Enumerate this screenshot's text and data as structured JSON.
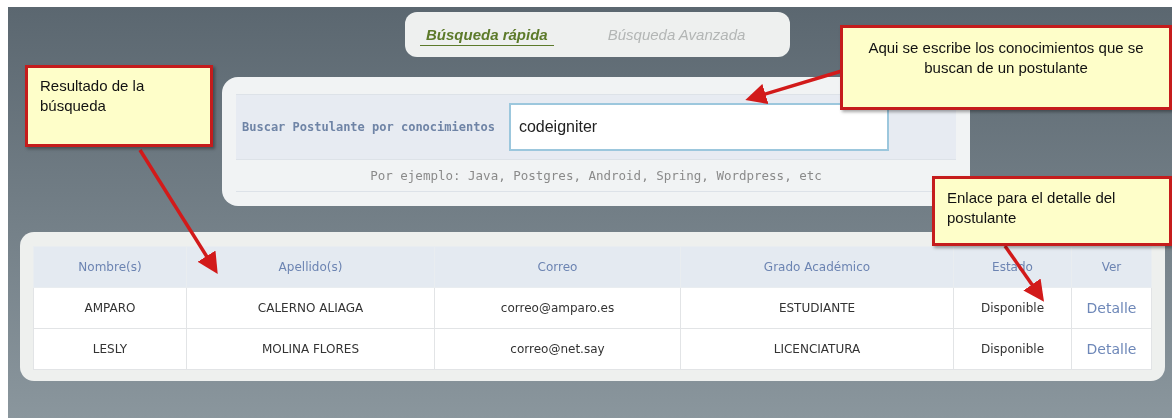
{
  "tabs": [
    {
      "label": "Búsqueda rápida",
      "selected": true
    },
    {
      "label": "Búsqueda Avanzada",
      "selected": false
    }
  ],
  "search": {
    "label": "Buscar Postulante por conocimientos",
    "value": "codeigniter",
    "hint": "Por ejemplo: Java, Postgres, Android, Spring, Wordpress, etc"
  },
  "table": {
    "columns": [
      "Nombre(s)",
      "Apellido(s)",
      "Correo",
      "Grado Académico",
      "Estado",
      "Ver"
    ],
    "rows": [
      [
        "AMPARO",
        "CALERNO ALIAGA",
        "correo@amparo.es",
        "ESTUDIANTE",
        "Disponible",
        "Detalle"
      ],
      [
        "LESLY",
        "MOLINA FLORES",
        "correo@net.say",
        "LICENCIATURA",
        "Disponible",
        "Detalle"
      ]
    ]
  },
  "callouts": [
    {
      "text": "Resultado de la búsqueda",
      "kind": "left"
    },
    {
      "text": "Aqui se escribe los conocimientos que se buscan de un postulante",
      "kind": "top"
    },
    {
      "text": "Enlace para el detalle del postulante",
      "kind": "right"
    }
  ]
}
